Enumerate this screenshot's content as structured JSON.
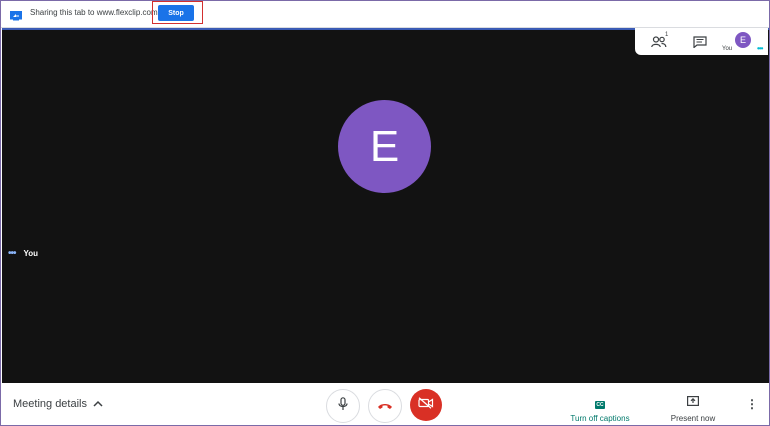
{
  "share_bar": {
    "text": "Sharing this tab to www.flexclip.com",
    "stop_label": "Stop",
    "stop_color": "#1a73e8",
    "highlight_color": "#d32f2f"
  },
  "stage": {
    "participant_initial": "E",
    "self_label": "You",
    "background": "#121212",
    "avatar_color": "#7e57c2"
  },
  "top_panel": {
    "people_count": "1",
    "avatar_initial": "E",
    "you_label": "You",
    "icons": [
      "people-icon",
      "chat-icon"
    ]
  },
  "bottom_bar": {
    "meeting_details_label": "Meeting details",
    "captions_label": "Turn off captions",
    "cc_icon_text": "CC",
    "present_label": "Present now",
    "more_icon_text": "⋮",
    "icons": [
      "chevron-up-icon",
      "mic-icon",
      "hangup-icon",
      "camera-off-icon",
      "captions-icon",
      "present-icon",
      "more-options-icon"
    ]
  }
}
